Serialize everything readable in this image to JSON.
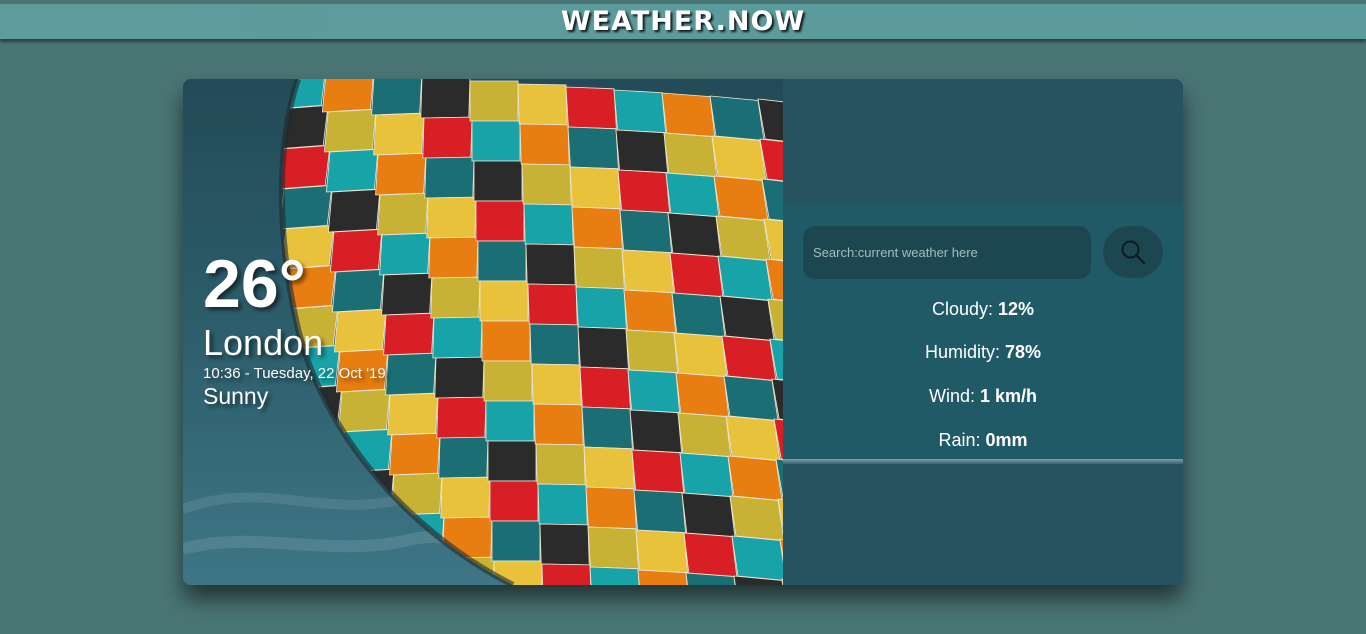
{
  "app": {
    "title": "WEATHER.NOW"
  },
  "current": {
    "temperature": "26°",
    "city": "London",
    "datetime": "10:36 - Tuesday, 22 Oct '19",
    "condition": "Sunny"
  },
  "search": {
    "placeholder": "Search:current weather here",
    "value": "",
    "icon": "search-icon"
  },
  "details": [
    {
      "label": "Cloudy:",
      "value": "12%"
    },
    {
      "label": "Humidity:",
      "value": "78%"
    },
    {
      "label": "Wind:",
      "value": "1 km/h"
    },
    {
      "label": "Rain:",
      "value": "0mm"
    }
  ],
  "colors": {
    "background": "#4a7575",
    "header": "#5e9b9b",
    "panel": "#27525f",
    "panel_mid": "#205a67",
    "input_bg": "#1c4750",
    "text": "#ffffff"
  }
}
